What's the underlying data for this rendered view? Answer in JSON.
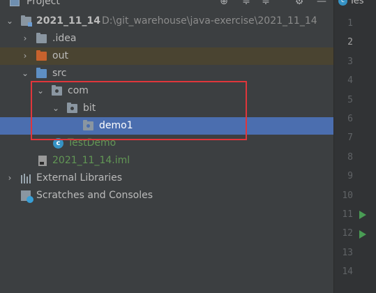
{
  "header": {
    "title": "Project",
    "chevron": "⌄",
    "buttons": [
      "⊕",
      "≑",
      "≑",
      "⚙",
      "—"
    ]
  },
  "tree": {
    "root": {
      "name": "2021_11_14",
      "path": "D:\\git_warehouse\\java-exercise\\2021_11_14"
    },
    "idea": ".idea",
    "out": "out",
    "src": "src",
    "com": "com",
    "bit": "bit",
    "demo1": "demo1",
    "testdemo": "TestDemo",
    "iml": "2021_11_14.iml",
    "external_libraries": "External Libraries",
    "scratches": "Scratches and Consoles"
  },
  "editor": {
    "tab_label": "Tes",
    "tab_icon": "c",
    "line_numbers": [
      "1",
      "2",
      "3",
      "4",
      "5",
      "6",
      "7",
      "8",
      "9",
      "10",
      "11",
      "12",
      "13",
      "14"
    ],
    "current_line": "2"
  },
  "colors": {
    "selection": "#4b6eaf",
    "highlight_box": "#e0363b",
    "excluded_folder": "#c7622d",
    "source_folder": "#5e8fc4",
    "vcs_added_text": "#629755",
    "run_icon": "#499c54"
  },
  "icons": {
    "arrow_expanded": "⌄",
    "arrow_collapsed": "›",
    "class": "c"
  }
}
